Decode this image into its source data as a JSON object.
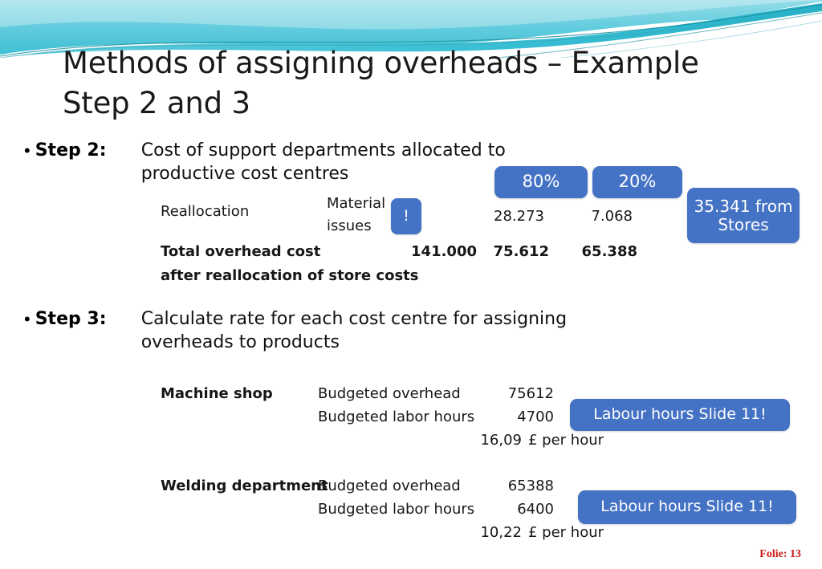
{
  "slide": {
    "title": "Methods of assigning overheads – Example\nStep 2 and 3",
    "footer": "Folie: 13",
    "accent_blue": "#4472C4",
    "banner_cyan": "#6FD3E2",
    "footer_color": "#CC1B1B"
  },
  "bullets": [
    {
      "marker": "•",
      "label": "Step 2:",
      "text": "Cost of support departments allocated to\nproductive cost centres"
    },
    {
      "marker": "•",
      "label": "Step 3:",
      "text": "Calculate rate for each cost centre for assigning\noverheads to products"
    }
  ],
  "step2_table": {
    "rows": [
      {
        "label": "Reallocation",
        "sub_label": "Material\nissues",
        "total": "",
        "col1": "28.273",
        "col2": "7.068"
      },
      {
        "label": "Total overhead cost",
        "label2": "after reallocation  of store costs",
        "total": "141.000",
        "col1": "75.612",
        "col2": "65.388"
      }
    ],
    "reallocation_label": "Reallocation",
    "material_issues": "Material",
    "material_issues2": "issues",
    "total_label_line1": "Total overhead cost",
    "total_label_line2": "after reallocation  of store costs",
    "total_value": "141.000",
    "alloc_col1": "28.273",
    "alloc_col2": "7.068",
    "total_col1": "75.612",
    "total_col2": "65.388"
  },
  "step3_tables": [
    {
      "department": "Machine shop",
      "row1_label": "Budgeted overhead",
      "row1_value": "75612",
      "row2_label": "Budgeted labor hours",
      "row2_value": "4700",
      "rate_value": "16,09",
      "rate_unit": "£ per hour"
    },
    {
      "department": "Welding department",
      "row1_label": "Budgeted overhead",
      "row1_value": "65388",
      "row2_label": "Budgeted labor hours",
      "row2_value": "6400",
      "rate_value": "10,22",
      "rate_unit": "£ per hour"
    }
  ],
  "callouts": {
    "exclamation": "!",
    "pct_80": "80%",
    "pct_20": "20%",
    "stores": "35.341 from Stores",
    "labour_hours_1": "Labour hours Slide 11!",
    "labour_hours_2": "Labour hours Slide 11!"
  }
}
